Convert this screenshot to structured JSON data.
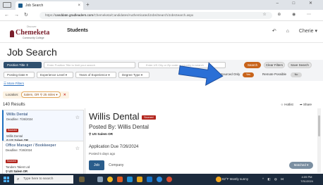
{
  "browser": {
    "tab_title": "Job Search",
    "url_prefix": "https://",
    "url_domain": "canddate.gradleaders.com",
    "url_path": "/Chemeketa/Candidates/Authenticated/Jobs/Search/JobsSearch.aspx",
    "new_tab": "+",
    "tab_close": "×",
    "window_controls": "‒ □ ✕"
  },
  "header": {
    "logo_top": "Discover",
    "logo_name": "Chemeketa",
    "logo_sub": "Community College",
    "section": "Students",
    "user_name": "Cherie ▾"
  },
  "page": {
    "title": "Job Search"
  },
  "filters": {
    "position_title_label": "Position Title ⇕",
    "keyword_placeholder": "Enter Position Title to limit your search",
    "location_placeholder": "Enter US City or Zip code or country to search",
    "search_button": "Search",
    "clear_button": "Clear Filters",
    "save_button": "Save Search",
    "posting_date": "Posting Date ▾",
    "experience_level": "Experience Level ▾",
    "years_experience": "Years of Experience ▾",
    "degree_type": "Degree Type ▾",
    "sourced_only_label": "Sourced Only",
    "sourced_only_value": "Yes",
    "remote_label": "Remote Possible",
    "remote_value": "No",
    "more_filters": "☰ More Filters"
  },
  "location": {
    "label": "Location:",
    "chip": "Salem, OR ⚲ 25 miles ▾",
    "remove": "✕"
  },
  "results": {
    "count": "140 Results",
    "hotlist": "☆ Hotlist",
    "share": "➦ Share",
    "items": [
      {
        "title": "Willis Dental",
        "deadline": "Deadline: 7/26/2024",
        "badge": "Sourced",
        "company": "Willis Dental",
        "location": "⚲ US Salem OR"
      },
      {
        "title": "Office Manager / Bookkeeper",
        "deadline": "Deadline: 7/26/2024",
        "badge": "Sourced",
        "company": "Tandem Talent Ltd",
        "location": "⚲ US Salem OR"
      }
    ]
  },
  "detail": {
    "title": "Willis Dental",
    "badge": "Sourced",
    "posted_by": "Posted By: Willis Dental",
    "location": "⚲ US Salem OR",
    "application_due": "Application Due 7/26/2024",
    "posted_ago": "Posted 5 days ago",
    "tab_job": "Job",
    "tab_company": "Company",
    "matched": "Matched ▾"
  },
  "taskbar": {
    "search_placeholder": "Type here to search",
    "weather": "82°F  Mostly sunny",
    "time": "4:09 PM",
    "date": "7/31/2024"
  },
  "colors": {
    "brand": "#7a1f2b",
    "accent_orange": "#c8641b",
    "navy": "#2e4f6e",
    "arrow": "#2a6fd6"
  }
}
